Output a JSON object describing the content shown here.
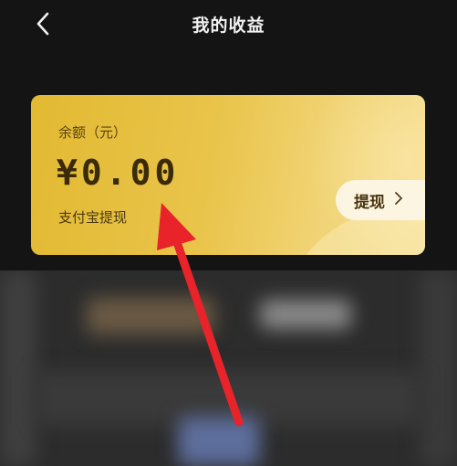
{
  "header": {
    "title": "我的收益",
    "back_icon": "chevron-left-icon"
  },
  "balance_card": {
    "label": "余额（元）",
    "amount": "¥0.00",
    "method": "支付宝提现",
    "withdraw_label": "提现",
    "withdraw_icon": "chevron-right-icon",
    "accent_color": "#e2b932"
  },
  "annotation": {
    "arrow_color": "#e8232a"
  }
}
